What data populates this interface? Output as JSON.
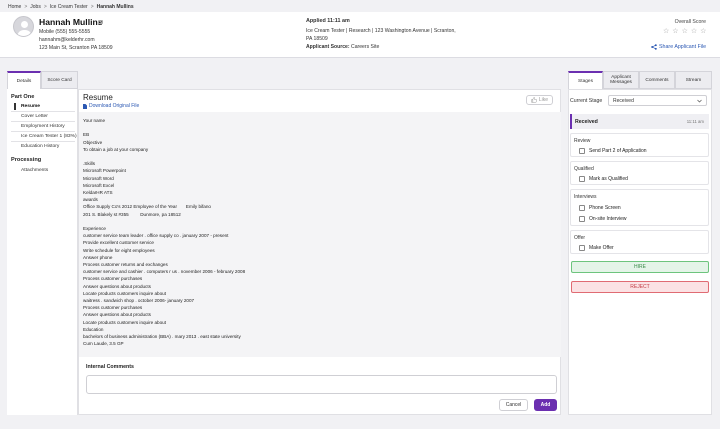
{
  "breadcrumb": {
    "home": "Home",
    "jobs": "Jobs",
    "job": "Ice Cream Tester",
    "current": "Hannah Mullins",
    "sep": ">"
  },
  "candidate": {
    "name": "Hannah Mullins",
    "mobile": "Mobile (555) 555-5555",
    "email": "hannahm@kelderhr.com",
    "address": "123 Main St, Scranton PA 18509"
  },
  "application": {
    "applied": "Applied 11:11 am",
    "job_line1": "Ice Cream Tester | Research | 123 Washington Avenue | Scranton,",
    "job_line2": "PA 18509",
    "source_label": "Applicant Source:",
    "source_value": "Careers Site"
  },
  "score": {
    "label": "Overall Score",
    "star": "☆"
  },
  "share": {
    "label": "Share Applicant File",
    "icon": "share-icon"
  },
  "left_tabs": {
    "details": "Details",
    "scorecard": "Score Card"
  },
  "nav": {
    "part_one": "Part One",
    "items": [
      "Resume",
      "Cover Letter",
      "Employment History",
      "Ice Cream Tester 1 (83%)",
      "Education History"
    ],
    "processing": "Processing",
    "processing_items": [
      "Attachments"
    ]
  },
  "resume": {
    "title": "Resume",
    "download": "Download Original File",
    "like": "Like",
    "lines": [
      "Your name",
      "    ",
      "EB",
      "Objective",
      "To obtain a job at your company",
      "",
      ".Skills",
      "Microsoft Powerpoint",
      "Microsoft Word",
      "Microsoft Excel",
      "KeldarHR ATS",
      "awards",
      "Office Supply Co's 2012 Employee of the Year       Emily bifano",
      "201 S. Blakely st #355         Dunmore, pa 18512",
      "",
      "Experience",
      "customer service team leader . office supply co . january 2007 - present",
      "Provide excellent customer service",
      "Write schedule for eight employees",
      "Answer phone",
      "Process customer returns and exchanges",
      "customer service and cashier . computers r us . november 2006 - february 2008",
      "Process customer purchases",
      "Answer questions about products",
      "Locate products customers inquire about",
      "waitress . sandwich shop . october 2006- january 2007",
      "Process customer purchases",
      "Answer questions about products",
      "Locate products customers inquire about",
      "Education",
      "bachelors of business administration (BBA) . mary 2013 . east state university",
      "Cum Laude, 3.5 GP"
    ]
  },
  "comments": {
    "label": "Internal Comments",
    "cancel": "Cancel",
    "add": "Add"
  },
  "right_tabs": {
    "stages": "Stages",
    "messages_l1": "Applicant",
    "messages_l2": "Messages",
    "comments": "Comments",
    "stream": "Stream"
  },
  "stage": {
    "current_label": "Current Stage",
    "current_value": "Received",
    "received": "Received",
    "received_time": "11:11 am",
    "review": "Review",
    "review_item": "Send Part 2 of Application",
    "qualified": "Qualified",
    "qualified_item": "Mark as Qualified",
    "interviews": "Interviews",
    "interview_items": [
      "Phone Screen",
      "On-site Interview"
    ],
    "offer": "Offer",
    "offer_item": "Make Offer",
    "hire": "HIRE",
    "reject": "REJECT"
  },
  "colors": {
    "accent": "#6b2fb0",
    "link": "#2b58b3",
    "hire": "#3a8a48",
    "reject": "#c23a43"
  }
}
